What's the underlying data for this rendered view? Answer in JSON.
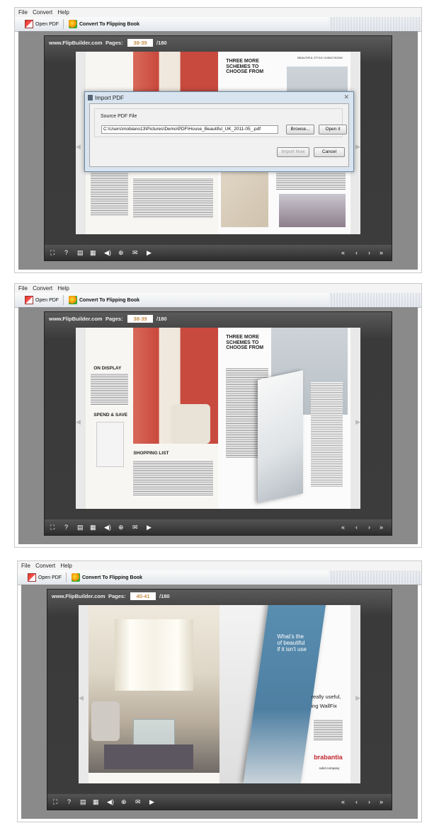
{
  "menu": {
    "file": "File",
    "convert": "Convert",
    "help": "Help"
  },
  "toolbar": {
    "open_pdf": "Open PDF",
    "convert": "Convert To Flipping Book"
  },
  "viewer": {
    "site": "www.FlipBuilder.com",
    "pages_label": "Pages:",
    "total": "/180"
  },
  "panels": [
    {
      "page_value": "38-39"
    },
    {
      "page_value": "38-39"
    },
    {
      "page_value": "40-41"
    }
  ],
  "dialog": {
    "title": "Import PDF",
    "source_label": "Source PDF File",
    "path": "C:\\Users\\mobiano13\\Pictures\\Demo\\PDF\\House_Beautiful_UK_2011-05_.pdf",
    "browse": "Browse...",
    "open_it": "Open it",
    "import_now": "Import Now",
    "cancel": "Cancel"
  },
  "magazine": {
    "heading_lines": [
      "THREE MORE",
      "SCHEMES TO",
      "CHOOSE FROM"
    ],
    "style_tag": "BEAUTIFUL STYLE LIVING ROOM",
    "shopping_list": "SHOPPING LIST",
    "on_display": "ON DISPLAY",
    "spend_save": "SPEND & SAVE",
    "ad_text": [
      "What's the",
      "of beautiful",
      "if it isn't use"
    ],
    "ad_tag": "really useful,",
    "ad_tag2": "ing WallFix",
    "brand": "brabantia",
    "brand_sub": "solid company"
  },
  "icons": {
    "bottom_left": [
      "fullscreen-icon",
      "help-icon",
      "print-icon",
      "thumbnails-icon",
      "sound-icon",
      "zoom-icon",
      "email-icon",
      "autoplay-icon"
    ],
    "bottom_right": [
      "first-page-icon",
      "prev-page-icon",
      "next-page-icon",
      "last-page-icon"
    ]
  }
}
